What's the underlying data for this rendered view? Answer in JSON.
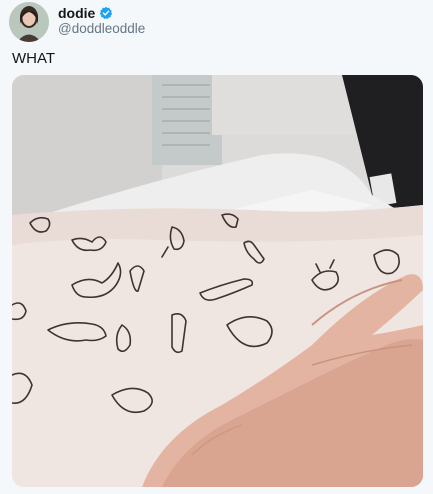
{
  "user": {
    "display_name": "dodie",
    "handle": "@doddleoddle",
    "verified": true
  },
  "tweet": {
    "text": "WHAT"
  },
  "icons": {
    "verified": "verified-badge-icon"
  },
  "colors": {
    "verified_blue": "#1da1f2",
    "handle_gray": "#657786",
    "background": "#f5f8fa"
  }
}
